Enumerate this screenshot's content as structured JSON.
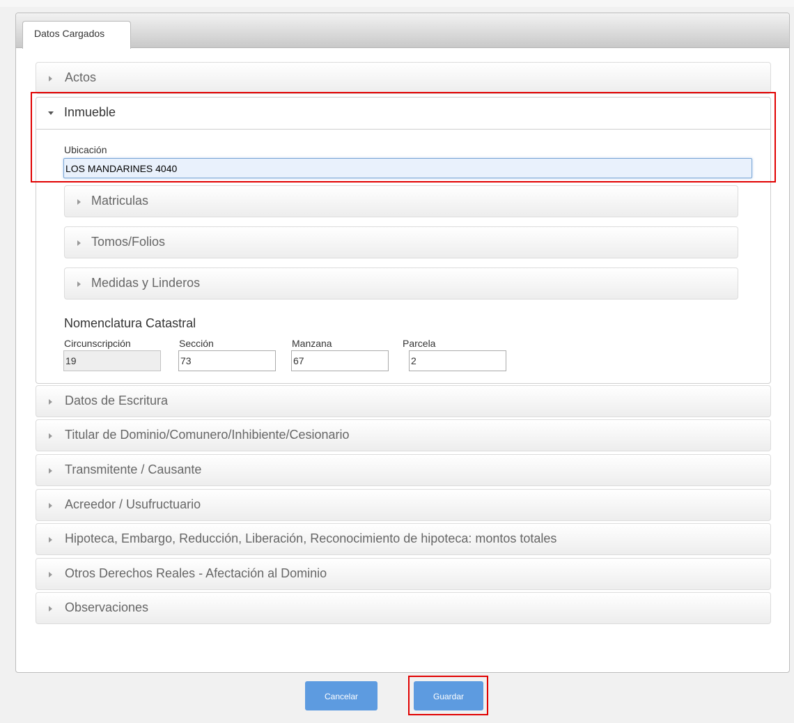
{
  "tab": {
    "label": "Datos Cargados"
  },
  "sections": {
    "actos": "Actos",
    "inmueble": "Inmueble",
    "datos_escritura": "Datos de Escritura",
    "titular": "Titular de Dominio/Comunero/Inhibiente/Cesionario",
    "transmitente": "Transmitente / Causante",
    "acreedor": "Acreedor / Usufructuario",
    "hipoteca": "Hipoteca, Embargo, Reducción, Liberación, Reconocimiento de hipoteca: montos totales",
    "otros_derechos": "Otros Derechos Reales - Afectación al Dominio",
    "observaciones": "Observaciones"
  },
  "inmueble": {
    "ubicacion_label": "Ubicación",
    "ubicacion_value": "LOS MANDARINES 4040",
    "subsections": {
      "matriculas": "Matriculas",
      "tomos_folios": "Tomos/Folios",
      "medidas": "Medidas y Linderos"
    },
    "nomenclatura": {
      "title": "Nomenclatura Catastral",
      "circunscripcion_label": "Circunscripción",
      "circunscripcion_value": "19",
      "seccion_label": "Sección",
      "seccion_value": "73",
      "manzana_label": "Manzana",
      "manzana_value": "67",
      "parcela_label": "Parcela",
      "parcela_value": "2"
    }
  },
  "buttons": {
    "cancelar": "Cancelar",
    "guardar": "Guardar"
  },
  "colors": {
    "highlight": "#e10000",
    "button": "#5d9be0"
  }
}
